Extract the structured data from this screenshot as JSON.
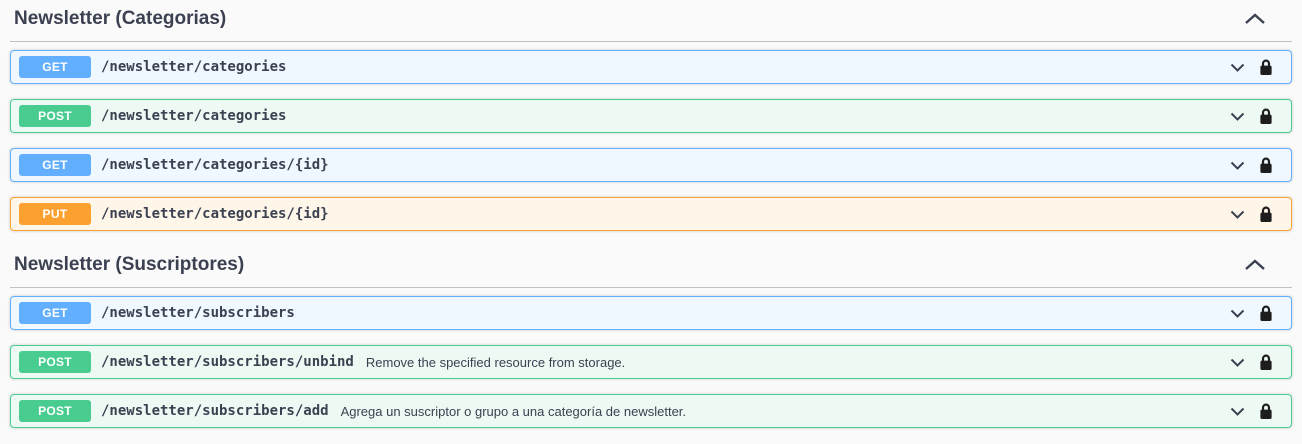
{
  "page": {
    "background_color": "#fafafa",
    "heading_color": "#3b4151",
    "divider_color": "rgba(59,65,81,0.3)"
  },
  "colors": {
    "get": {
      "badge": "#61affe",
      "bg": "#eff7ff"
    },
    "post": {
      "badge": "#49cc90",
      "bg": "#edfaf4"
    },
    "put": {
      "badge": "#fca130",
      "bg": "#fff6ea"
    }
  },
  "icons": {
    "section_collapse": "chevron-up-icon",
    "operation_expand": "chevron-down-icon",
    "operation_auth": "lock-icon"
  },
  "sections": [
    {
      "title": "Newsletter (Categorias)",
      "collapse_icon": "chevron-up",
      "operations": [
        {
          "method": "GET",
          "path": "/newsletter/categories",
          "description": "",
          "expand_icon": "chevron-down",
          "auth_icon": "lock-closed"
        },
        {
          "method": "POST",
          "path": "/newsletter/categories",
          "description": "",
          "expand_icon": "chevron-down",
          "auth_icon": "lock-closed"
        },
        {
          "method": "GET",
          "path": "/newsletter/categories/{id}",
          "description": "",
          "expand_icon": "chevron-down",
          "auth_icon": "lock-closed"
        },
        {
          "method": "PUT",
          "path": "/newsletter/categories/{id}",
          "description": "",
          "expand_icon": "chevron-down",
          "auth_icon": "lock-closed"
        }
      ]
    },
    {
      "title": "Newsletter (Suscriptores)",
      "collapse_icon": "chevron-up",
      "operations": [
        {
          "method": "GET",
          "path": "/newsletter/subscribers",
          "description": "",
          "expand_icon": "chevron-down",
          "auth_icon": "lock-closed"
        },
        {
          "method": "POST",
          "path": "/newsletter/subscribers/unbind",
          "description": "Remove the specified resource from storage.",
          "expand_icon": "chevron-down",
          "auth_icon": "lock-closed"
        },
        {
          "method": "POST",
          "path": "/newsletter/subscribers/add",
          "description": "Agrega un suscriptor o grupo a una categoría de newsletter.",
          "expand_icon": "chevron-down",
          "auth_icon": "lock-closed"
        }
      ]
    }
  ]
}
